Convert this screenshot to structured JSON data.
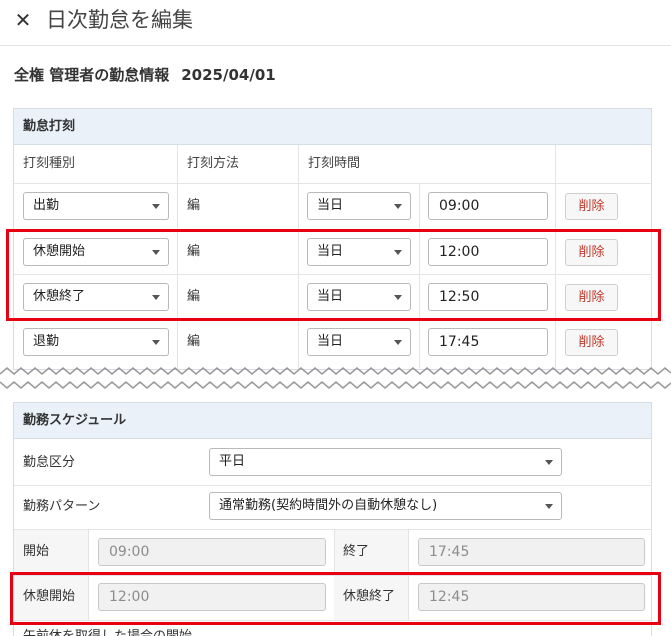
{
  "header": {
    "title": "日次勤怠を編集"
  },
  "subhead": {
    "name": "全権 管理者の勤怠情報",
    "date": "2025/04/01"
  },
  "punch_section": {
    "title": "勤怠打刻",
    "columns": {
      "type": "打刻種別",
      "method": "打刻方法",
      "time": "打刻時間"
    },
    "rows": [
      {
        "type": "出勤",
        "method": "編",
        "day": "当日",
        "time": "09:00",
        "delete_label": "削除"
      },
      {
        "type": "休憩開始",
        "method": "編",
        "day": "当日",
        "time": "12:00",
        "delete_label": "削除"
      },
      {
        "type": "休憩終了",
        "method": "編",
        "day": "当日",
        "time": "12:50",
        "delete_label": "削除"
      },
      {
        "type": "退勤",
        "method": "編",
        "day": "当日",
        "time": "17:45",
        "delete_label": "削除"
      }
    ]
  },
  "schedule_section": {
    "title": "勤務スケジュール",
    "attendance_type": {
      "label": "勤怠区分",
      "value": "平日"
    },
    "work_pattern": {
      "label": "勤務パターン",
      "value": "通常勤務(契約時間外の自動休憩なし)"
    },
    "start": {
      "label": "開始",
      "value": "09:00"
    },
    "end": {
      "label": "終了",
      "value": "17:45"
    },
    "break_start": {
      "label": "休憩開始",
      "value": "12:00"
    },
    "break_end": {
      "label": "休憩終了",
      "value": "12:45"
    },
    "next_row_label": "午前休を取得した場合の開始"
  },
  "colors": {
    "highlight": "#e60012",
    "panel_header": "#eaf1f9",
    "delete_text": "#c0392b"
  }
}
